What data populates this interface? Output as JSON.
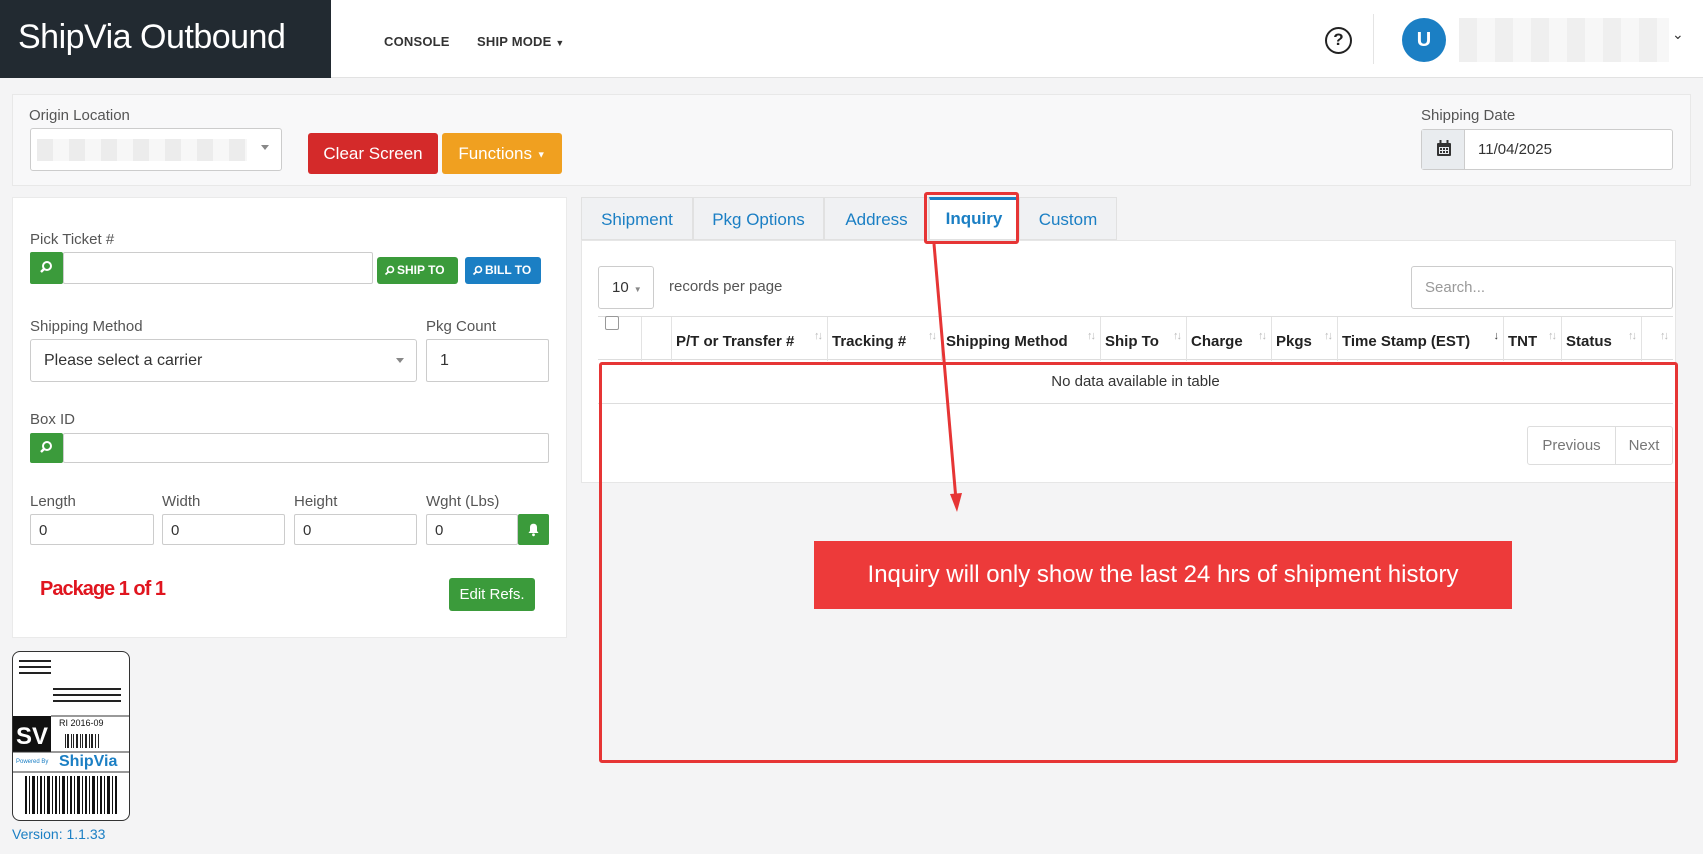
{
  "header": {
    "brand": "ShipVia Outbound",
    "nav": {
      "console": "CONSOLE",
      "ship_mode": "SHIP MODE"
    },
    "help_icon": "?",
    "avatar_initial": "U"
  },
  "topbar": {
    "origin_label": "Origin Location",
    "clear_button": "Clear Screen",
    "functions_button": "Functions",
    "shipping_date_label": "Shipping Date",
    "shipping_date_value": "11/04/2025"
  },
  "form": {
    "pick_ticket_label": "Pick Ticket #",
    "ship_to_button": "SHIP TO",
    "bill_to_button": "BILL TO",
    "shipping_method_label": "Shipping Method",
    "shipping_method_value": "Please select a carrier",
    "pkg_count_label": "Pkg Count",
    "pkg_count_value": "1",
    "box_id_label": "Box ID",
    "length_label": "Length",
    "length_value": "0",
    "width_label": "Width",
    "width_value": "0",
    "height_label": "Height",
    "height_value": "0",
    "weight_label": "Wght (Lbs)",
    "weight_value": "0",
    "package_label": "Package 1 of 1",
    "edit_refs_button": "Edit Refs."
  },
  "logo": {
    "sv": "SV",
    "code": "RI 2016-09",
    "powered_by": "Powered By",
    "brand": "ShipVia"
  },
  "version": "Version: 1.1.33",
  "tabs": [
    {
      "label": "Shipment"
    },
    {
      "label": "Pkg Options"
    },
    {
      "label": "Address"
    },
    {
      "label": "Inquiry",
      "active": true
    },
    {
      "label": "Custom"
    }
  ],
  "inquiry": {
    "per_page_value": "10",
    "per_page_label": "records per page",
    "search_placeholder": "Search...",
    "columns": [
      "P/T or Transfer #",
      "Tracking #",
      "Shipping Method",
      "Ship To",
      "Charge",
      "Pkgs",
      "Time Stamp (EST)",
      "TNT",
      "Status"
    ],
    "empty_message": "No data available in table",
    "previous": "Previous",
    "next": "Next"
  },
  "annotation": {
    "callout": "Inquiry will only show the last 24 hrs of shipment history",
    "color": "#e63535"
  },
  "colors": {
    "brand_dark": "#222a31",
    "accent_blue": "#1b7fc4",
    "success_green": "#3b9b3b",
    "danger_red": "#d42a2a",
    "warning_orange": "#f0a020"
  }
}
